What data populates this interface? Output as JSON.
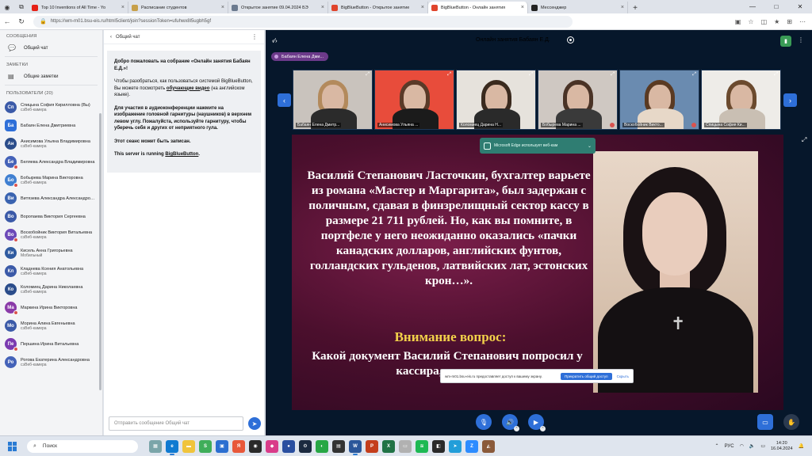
{
  "browser": {
    "tabs": [
      {
        "title": "Top 10 Inventions of All Time - Yo",
        "color": "#e62117",
        "active": false
      },
      {
        "title": "Расписание студентов",
        "color": "#c7a04a",
        "active": false
      },
      {
        "title": "Открытое занятие 09.04.2024 БЭ",
        "color": "#6b7a8f",
        "active": false
      },
      {
        "title": "BigBlueButton - Открытое занятие",
        "color": "#e0442c",
        "active": false
      },
      {
        "title": "BigBlueButton - Онлайн занятия",
        "color": "#e0442c",
        "active": true
      },
      {
        "title": "Мессенджер",
        "color": "#222222",
        "active": false
      }
    ],
    "url": "https://wm-m01.bsu-eis.ru/html5client/join?sessionToken=ufuhwx8l5ugbh5gf"
  },
  "sidebar": {
    "messages_title": "СООБЩЕНИЯ",
    "public_chat": "Общий чат",
    "notes_title": "ЗАМЕТКИ",
    "shared_notes": "Общие заметки",
    "users_title": "ПОЛЬЗОВАТЕЛИ (20)",
    "users": [
      {
        "initials": "Сп",
        "name": "Спицына София Кирилловна (Вы)",
        "status": "сэВеб-камера",
        "color": "#3b5aa8",
        "round": true,
        "muted": false
      },
      {
        "initials": "Ба",
        "name": "Бабаян Елена Дмитриевна",
        "status": "",
        "color": "#2e6fd8",
        "round": false,
        "muted": false
      },
      {
        "initials": "Ан",
        "name": "Анисимова Ульяна Владимировна",
        "status": "сэВеб-камера",
        "color": "#2a4c8a",
        "round": true,
        "muted": false
      },
      {
        "initials": "Бе",
        "name": "Беляева Александра Владимировна",
        "status": "",
        "color": "#4462b8",
        "round": true,
        "muted": true
      },
      {
        "initials": "Бо",
        "name": "Бобырева Марина Викторовна",
        "status": "сэВеб-камера",
        "color": "#3f7fd1",
        "round": true,
        "muted": true
      },
      {
        "initials": "Ви",
        "name": "Витязева Александра Александровна",
        "status": "",
        "color": "#3a63b0",
        "round": true,
        "muted": false
      },
      {
        "initials": "Во",
        "name": "Воропаева Виктория Сергеевна",
        "status": "",
        "color": "#3b5aa8",
        "round": true,
        "muted": false
      },
      {
        "initials": "Во",
        "name": "Воскобойник Виктория Витальевна",
        "status": "сэВеб-камера",
        "color": "#6c49b8",
        "round": true,
        "muted": true
      },
      {
        "initials": "Ки",
        "name": "Кисель Анна Григорьевна",
        "status": "Мобильный",
        "color": "#2f5aa0",
        "round": true,
        "muted": false
      },
      {
        "initials": "Кл",
        "name": "Кладнева Ксения Анатольевна",
        "status": "сэВеб-камера",
        "color": "#3b5aa8",
        "round": true,
        "muted": false
      },
      {
        "initials": "Ко",
        "name": "Коломиец Дарина Николаевна",
        "status": "сэВеб-камера",
        "color": "#2a4c8a",
        "round": true,
        "muted": false
      },
      {
        "initials": "Ма",
        "name": "Маркина Ирина Викторовна",
        "status": "",
        "color": "#8a3aa8",
        "round": true,
        "muted": true
      },
      {
        "initials": "Мо",
        "name": "Морина Алина Евгеньевна",
        "status": "сэВеб-камера",
        "color": "#3b5aa8",
        "round": true,
        "muted": false
      },
      {
        "initials": "Пе",
        "name": "Першина Ирина Витальевна",
        "status": "",
        "color": "#7a3ab0",
        "round": true,
        "muted": true
      },
      {
        "initials": "Ро",
        "name": "Рогова Екатерина Александровна",
        "status": "сэВеб-камера",
        "color": "#4462b8",
        "round": true,
        "muted": false
      }
    ]
  },
  "chat": {
    "back_label": "Общий чат",
    "welcome_line1a": "Добро пожаловать на собрание «",
    "welcome_line1b": "Онлайн занятия Бабаян Е.Д.",
    "welcome_line1c": "»!",
    "welcome_p2a": "Чтобы разобраться, как пользоваться системой BigBlueButton, Вы можете посмотреть ",
    "welcome_p2link": "обучающие видео",
    "welcome_p2b": " (на английском языке).",
    "welcome_p3": "Для участия в аудиоконференции нажмите на изображение головной гарнитуры (наушников) в верхнем левом углу. Пожалуйста, используйте гарнитуру, чтобы уберечь себя и других от неприятного гула.",
    "welcome_p4": "Этот сеанс может быть записан.",
    "welcome_p5a": "This server is running ",
    "welcome_p5link": "BigBlueButton",
    "welcome_p5b": ".",
    "input_placeholder": "Отправить сообщение Общий чат"
  },
  "meeting": {
    "title": "Онлайн занятия Бабаян Е.Д.",
    "presenter": "Бабаян Елена Дми...",
    "videos": [
      {
        "name": "Бабаян Елена Дмитр...",
        "bg": "#c9c3bd",
        "hair": "#b38a5c",
        "body": "#2b2b2b",
        "muted": false
      },
      {
        "name": "Анисимова Ульяна ...",
        "bg": "#e84c3b",
        "hair": "#5a3a28",
        "body": "#1b1b1b",
        "muted": false
      },
      {
        "name": "Коломиец Дарина Н...",
        "bg": "#e6e2dc",
        "hair": "#3a2a1e",
        "body": "#2a2a2a",
        "muted": false
      },
      {
        "name": "Бобырева Марина ...",
        "bg": "#cfc8c2",
        "hair": "#4a3326",
        "body": "#3a3a3a",
        "muted": true
      },
      {
        "name": "Воскобойник Викто...",
        "bg": "#6a8bb0",
        "hair": "#5a3a22",
        "body": "#e7d8c8",
        "muted": true
      },
      {
        "name": "Спицына София Ки...",
        "bg": "#eeece8",
        "hair": "#6b4a2e",
        "body": "#c9bfb3",
        "muted": false
      }
    ]
  },
  "slide": {
    "text": "Василий Степанович Ласточкин, бухгалтер варьете из романа «Мастер и Маргарита», был задержан с поличным, сдавая в финзрелищный сектор кассу в размере 21 711 рублей. Но, как вы помните, в портфеле у него неожиданно оказались «пачки канадских долларов, английских фунтов, голландских гульденов, латвийских лат, эстонских крон…».",
    "attention": "Внимание вопрос:",
    "question": "Какой документ Василий Степанович попросил у кассира, когда при"
  },
  "edge_toast": "Microsoft Edge использует веб-кам",
  "share_bar": {
    "text": "wm-m01.bsu-eis.ru предоставляет доступ к вашему экрану.",
    "primary": "Прекратить общий доступ",
    "hide": "Скрыть"
  },
  "taskbar": {
    "search": "Поиск",
    "lang": "РУС",
    "time": "14:20",
    "date": "16.04.2024"
  }
}
